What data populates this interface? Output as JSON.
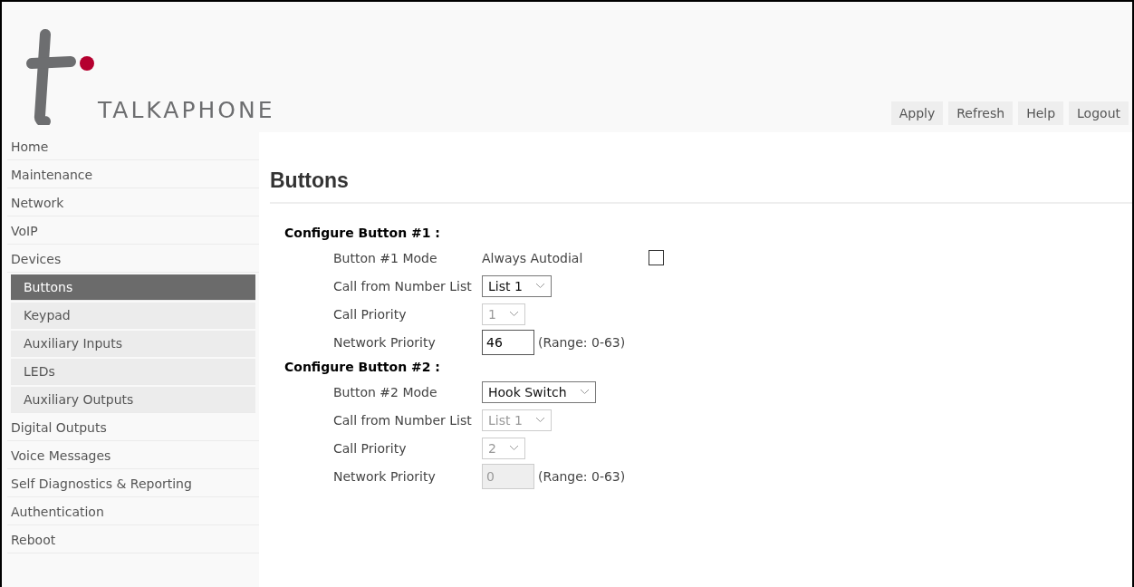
{
  "brand": {
    "name": "TALKAPHONE"
  },
  "header_buttons": [
    "Apply",
    "Refresh",
    "Help",
    "Logout"
  ],
  "sidebar": {
    "items": [
      {
        "label": "Home",
        "selected": false
      },
      {
        "label": "Maintenance",
        "selected": false
      },
      {
        "label": "Network",
        "selected": false
      },
      {
        "label": "VoIP",
        "selected": false
      },
      {
        "label": "Devices",
        "selected": false,
        "children": [
          {
            "label": "Buttons",
            "selected": true
          },
          {
            "label": "Keypad",
            "selected": false
          },
          {
            "label": "Auxiliary Inputs",
            "selected": false
          },
          {
            "label": "LEDs",
            "selected": false
          },
          {
            "label": "Auxiliary Outputs",
            "selected": false
          }
        ]
      },
      {
        "label": "Digital Outputs",
        "selected": false
      },
      {
        "label": "Voice Messages",
        "selected": false
      },
      {
        "label": "Self Diagnostics & Reporting",
        "selected": false
      },
      {
        "label": "Authentication",
        "selected": false
      },
      {
        "label": "Reboot",
        "selected": false
      }
    ]
  },
  "page_title": "Buttons",
  "sections": [
    {
      "title": "Configure Button #1 :",
      "rows": [
        {
          "kind": "checkbox",
          "label": "Button #1 Mode",
          "value": "Always Autodial",
          "checked": false
        },
        {
          "kind": "select",
          "label": "Call from Number List",
          "value": "List 1",
          "disabled": false
        },
        {
          "kind": "select",
          "label": "Call Priority",
          "value": "1",
          "disabled": true
        },
        {
          "kind": "input",
          "label": "Network Priority",
          "value": "46",
          "disabled": false,
          "note": "(Range: 0-63)"
        }
      ]
    },
    {
      "title": "Configure Button #2 :",
      "rows": [
        {
          "kind": "select",
          "label": "Button #2 Mode",
          "value": "Hook Switch",
          "disabled": false
        },
        {
          "kind": "select",
          "label": "Call from Number List",
          "value": "List 1",
          "disabled": true
        },
        {
          "kind": "select",
          "label": "Call Priority",
          "value": "2",
          "disabled": true
        },
        {
          "kind": "input",
          "label": "Network Priority",
          "value": "0",
          "disabled": true,
          "note": "(Range: 0-63)"
        }
      ]
    }
  ]
}
